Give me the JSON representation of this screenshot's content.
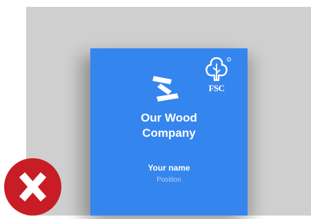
{
  "card": {
    "company_line1": "Our Wood",
    "company_line2": "Company",
    "name": "Your name",
    "position": "Position",
    "background_color": "#3585ef"
  },
  "certification": {
    "label": "FSC",
    "icon": "fsc-tree-logo"
  },
  "logo": {
    "icon": "wood-company-logo"
  },
  "badge": {
    "icon": "x-mark-icon",
    "meaning": "incorrect",
    "color": "#c81d25"
  },
  "colors": {
    "stage": "#cfcfcf",
    "text_primary": "#ffffff",
    "text_secondary": "#b8d3f7"
  }
}
